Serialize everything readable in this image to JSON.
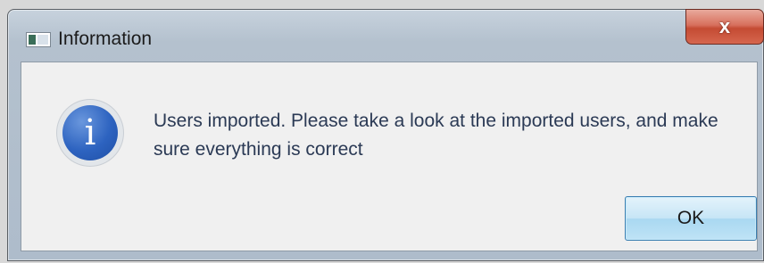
{
  "dialog": {
    "title": "Information",
    "close_label": "x",
    "message": "Users imported. Please take a look at the imported users, and make sure everything is correct",
    "ok_label": "OK",
    "info_icon_glyph": "i"
  }
}
